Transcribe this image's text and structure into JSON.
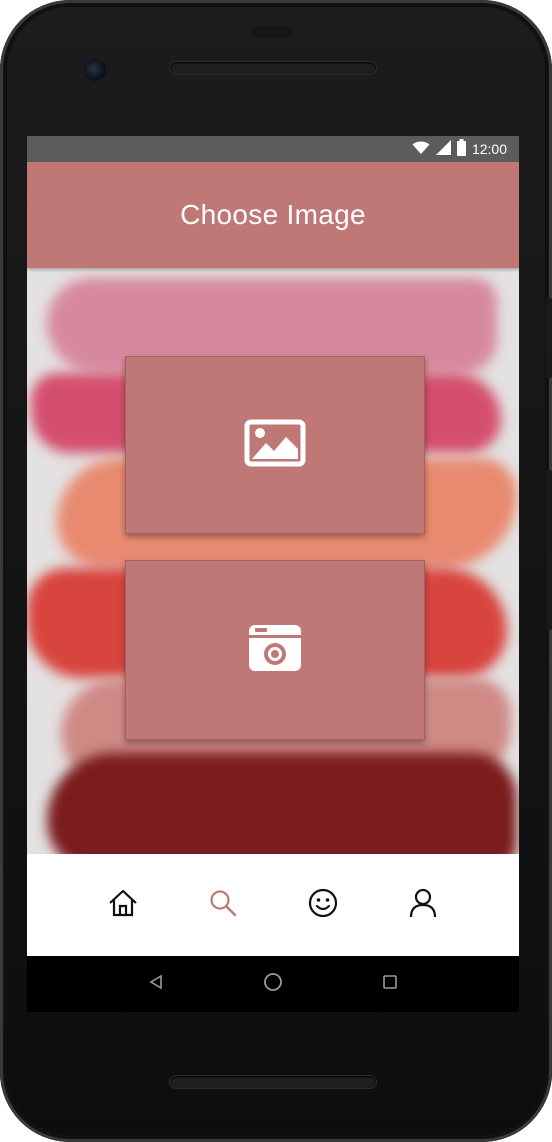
{
  "status_bar": {
    "time": "12:00",
    "icons": [
      "wifi-icon",
      "cell-signal-icon",
      "battery-icon"
    ]
  },
  "app_bar": {
    "title": "Choose Image"
  },
  "actions": [
    {
      "name": "choose-from-gallery",
      "icon": "image-icon"
    },
    {
      "name": "take-photo",
      "icon": "camera-icon"
    }
  ],
  "bottom_nav": {
    "items": [
      {
        "icon": "home-icon",
        "active": false
      },
      {
        "icon": "search-icon",
        "active": true
      },
      {
        "icon": "smiley-icon",
        "active": false
      },
      {
        "icon": "profile-icon",
        "active": false
      }
    ]
  },
  "system_nav": [
    "back-icon",
    "home-circle-icon",
    "recents-icon"
  ],
  "colors": {
    "accent": "#c07876",
    "status_bar": "#5c5c5c",
    "nav_active": "#c07876",
    "nav_inactive": "#111111"
  }
}
